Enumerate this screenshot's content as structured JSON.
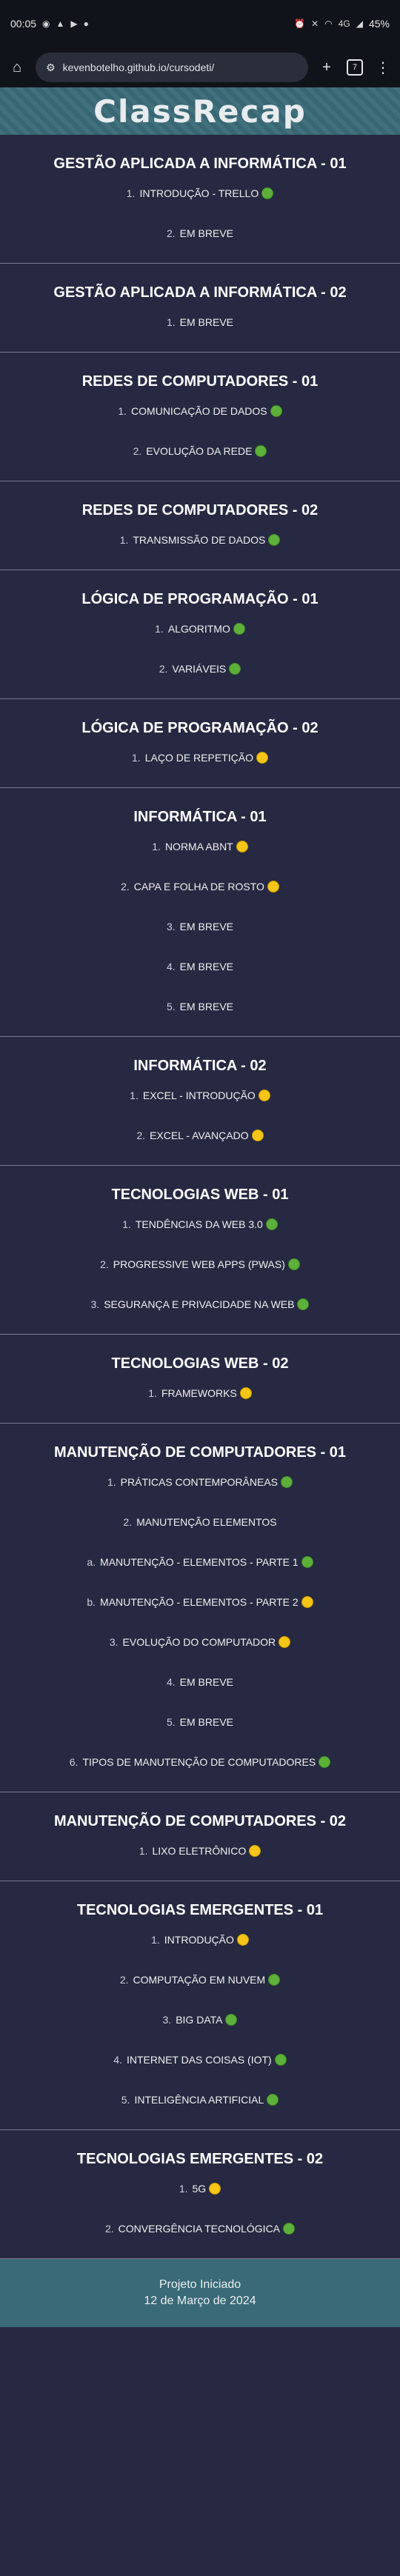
{
  "statusbar": {
    "time": "00:05",
    "battery": "45%",
    "network": "4G"
  },
  "browser": {
    "url": "kevenbotelho.github.io/cursodeti/",
    "tab_count": "7"
  },
  "site": {
    "title": "ClassRecap"
  },
  "courses": [
    {
      "title": "GESTÃO APLICADA A INFORMÁTICA - 01",
      "topics": [
        {
          "num": "1.",
          "label": "INTRODUÇÃO - TRELLO",
          "status": "green"
        },
        {
          "num": "2.",
          "label": "EM BREVE",
          "status": ""
        }
      ]
    },
    {
      "title": "GESTÃO APLICADA A INFORMÁTICA - 02",
      "topics": [
        {
          "num": "1.",
          "label": "EM BREVE",
          "status": ""
        }
      ]
    },
    {
      "title": "REDES DE COMPUTADORES - 01",
      "topics": [
        {
          "num": "1.",
          "label": "COMUNICAÇÃO DE DADOS",
          "status": "green"
        },
        {
          "num": "2.",
          "label": "EVOLUÇÃO DA REDE",
          "status": "green"
        }
      ]
    },
    {
      "title": "REDES DE COMPUTADORES - 02",
      "topics": [
        {
          "num": "1.",
          "label": "TRANSMISSÃO DE DADOS",
          "status": "green"
        }
      ]
    },
    {
      "title": "LÓGICA DE PROGRAMAÇÃO - 01",
      "topics": [
        {
          "num": "1.",
          "label": "ALGORITMO",
          "status": "green"
        },
        {
          "num": "2.",
          "label": "VARIÁVEIS",
          "status": "green"
        }
      ]
    },
    {
      "title": "LÓGICA DE PROGRAMAÇÃO - 02",
      "topics": [
        {
          "num": "1.",
          "label": "LAÇO DE REPETIÇÃO",
          "status": "yellow"
        }
      ]
    },
    {
      "title": "INFORMÁTICA - 01",
      "topics": [
        {
          "num": "1.",
          "label": "NORMA ABNT",
          "status": "yellow"
        },
        {
          "num": "2.",
          "label": "CAPA E FOLHA DE ROSTO",
          "status": "yellow"
        },
        {
          "num": "3.",
          "label": "EM BREVE",
          "status": ""
        },
        {
          "num": "4.",
          "label": "EM BREVE",
          "status": ""
        },
        {
          "num": "5.",
          "label": "EM BREVE",
          "status": ""
        }
      ]
    },
    {
      "title": "INFORMÁTICA - 02",
      "topics": [
        {
          "num": "1.",
          "label": "EXCEL - INTRODUÇÃO",
          "status": "yellow"
        },
        {
          "num": "2.",
          "label": "EXCEL - AVANÇADO",
          "status": "yellow"
        }
      ]
    },
    {
      "title": "TECNOLOGIAS WEB - 01",
      "topics": [
        {
          "num": "1.",
          "label": "TENDÊNCIAS DA WEB 3.0",
          "status": "green"
        },
        {
          "num": "2.",
          "label": "PROGRESSIVE WEB APPS (PWAS)",
          "status": "green"
        },
        {
          "num": "3.",
          "label": "SEGURANÇA E PRIVACIDADE NA WEB",
          "status": "green"
        }
      ]
    },
    {
      "title": "TECNOLOGIAS WEB - 02",
      "topics": [
        {
          "num": "1.",
          "label": "FRAMEWORKS",
          "status": "yellow"
        }
      ]
    },
    {
      "title": "MANUTENÇÃO DE COMPUTADORES - 01",
      "topics": [
        {
          "num": "1.",
          "label": "PRÁTICAS CONTEMPORÂNEAS",
          "status": "green"
        },
        {
          "num": "2.",
          "label": "MANUTENÇÃO ELEMENTOS",
          "status": ""
        },
        {
          "num": "a.",
          "label": "MANUTENÇÃO - ELEMENTOS - PARTE 1",
          "status": "green"
        },
        {
          "num": "b.",
          "label": "MANUTENÇÃO - ELEMENTOS - PARTE 2",
          "status": "yellow"
        },
        {
          "num": "3.",
          "label": "EVOLUÇÃO DO COMPUTADOR",
          "status": "yellow"
        },
        {
          "num": "4.",
          "label": "EM BREVE",
          "status": ""
        },
        {
          "num": "5.",
          "label": "EM BREVE",
          "status": ""
        },
        {
          "num": "6.",
          "label": "TIPOS DE MANUTENÇÃO DE COMPUTADORES",
          "status": "green"
        }
      ]
    },
    {
      "title": "MANUTENÇÃO DE COMPUTADORES - 02",
      "topics": [
        {
          "num": "1.",
          "label": "LIXO ELETRÔNICO",
          "status": "yellow"
        }
      ]
    },
    {
      "title": "TECNOLOGIAS EMERGENTES - 01",
      "topics": [
        {
          "num": "1.",
          "label": "INTRODUÇÃO",
          "status": "yellow"
        },
        {
          "num": "2.",
          "label": "COMPUTAÇÃO EM NUVEM",
          "status": "green"
        },
        {
          "num": "3.",
          "label": "BIG DATA",
          "status": "green"
        },
        {
          "num": "4.",
          "label": "INTERNET DAS COISAS (IOT)",
          "status": "green"
        },
        {
          "num": "5.",
          "label": "INTELIGÊNCIA ARTIFICIAL",
          "status": "green"
        }
      ]
    },
    {
      "title": "TECNOLOGIAS EMERGENTES - 02",
      "topics": [
        {
          "num": "1.",
          "label": "5G",
          "status": "yellow"
        },
        {
          "num": "2.",
          "label": "CONVERGÊNCIA TECNOLÓGICA",
          "status": "green"
        }
      ]
    }
  ],
  "footer": {
    "line1": "Projeto Iniciado",
    "line2": "12 de Março de 2024"
  },
  "colors": {
    "green": "#5db03a",
    "yellow": "#f5c518",
    "header": "#3a6a78",
    "background": "#262941"
  }
}
